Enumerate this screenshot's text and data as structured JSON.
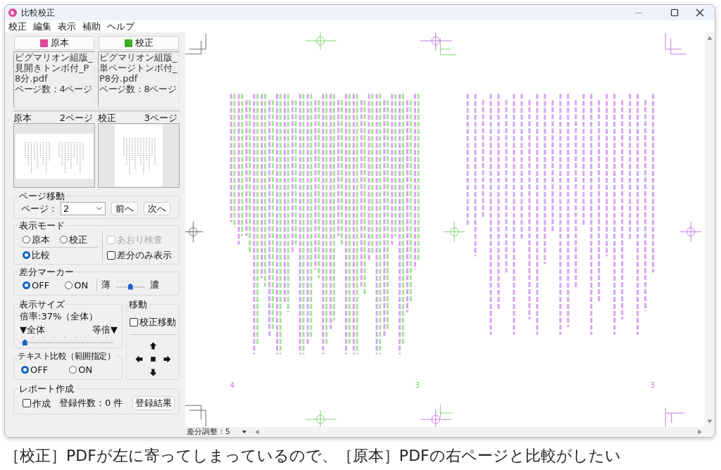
{
  "window": {
    "title": "比較校正"
  },
  "menu": [
    {
      "label": "校正"
    },
    {
      "label": "編集"
    },
    {
      "label": "表示"
    },
    {
      "label": "補助"
    },
    {
      "label": "ヘルプ"
    }
  ],
  "documents": [
    {
      "button": "原本",
      "color": "#e0489c",
      "file_name": "ピグマリオン組版_見開きトンボ付_P8分.pdf",
      "page_count": "ページ数：4ページ",
      "thumb_title": "原本",
      "thumb_page": "2ページ",
      "kind": "spread"
    },
    {
      "button": "校正",
      "color": "#3faa2a",
      "file_name": "ピグマリオン組版_単ページトンボ付_P8分.pdf",
      "page_count": "ページ数：8ページ",
      "thumb_title": "校正",
      "thumb_page": "3ページ",
      "kind": "single"
    }
  ],
  "page_nav": {
    "title": "ページ移動",
    "label": "ページ：",
    "value": "2",
    "buttons": [
      {
        "label": "前へ"
      },
      {
        "label": "次へ"
      }
    ]
  },
  "display_mode": {
    "title": "表示モード",
    "radios": [
      {
        "label": "原本",
        "selected": false
      },
      {
        "label": "校正",
        "selected": false
      },
      {
        "label": "比較",
        "selected": true
      }
    ],
    "checkboxes": [
      {
        "label": "あおり検査",
        "checked": false,
        "disabled": true
      },
      {
        "label": "差分のみ表示",
        "checked": false,
        "disabled": false
      }
    ]
  },
  "diff_marker": {
    "title": "差分マーカー",
    "radios": [
      {
        "label": "OFF",
        "selected": true
      },
      {
        "label": "ON",
        "selected": false
      }
    ],
    "min_label": "薄",
    "max_label": "濃",
    "level": 0.5
  },
  "display_size": {
    "title": "表示サイズ",
    "zoom": "倍率:37%（全体）",
    "min_label": "▼全体",
    "max_label": "等倍▼",
    "level": 0.03
  },
  "move": {
    "title": "移動",
    "checkbox": {
      "label": "校正移動",
      "checked": false
    }
  },
  "text_compare": {
    "title": "テキスト比較（範囲指定）",
    "radios": [
      {
        "label": "OFF",
        "selected": true
      },
      {
        "label": "ON",
        "selected": false
      }
    ]
  },
  "report": {
    "title": "レポート作成",
    "checkbox": {
      "label": "作成",
      "checked": false
    },
    "count": "登録件数：0 件",
    "button": "登録結果"
  },
  "canvas": {
    "page_numbers": [
      {
        "text": "4",
        "color": "#c77ae6"
      },
      {
        "text": "3",
        "color": "#7fd46e"
      },
      {
        "text": "3",
        "color": "#c77ae6"
      }
    ]
  },
  "status_bar": {
    "diff_adjust": "差分調整：5"
  },
  "caption": "［校正］PDFが左に寄ってしまっているので、［原本］PDFの右ページと比較がしたい"
}
